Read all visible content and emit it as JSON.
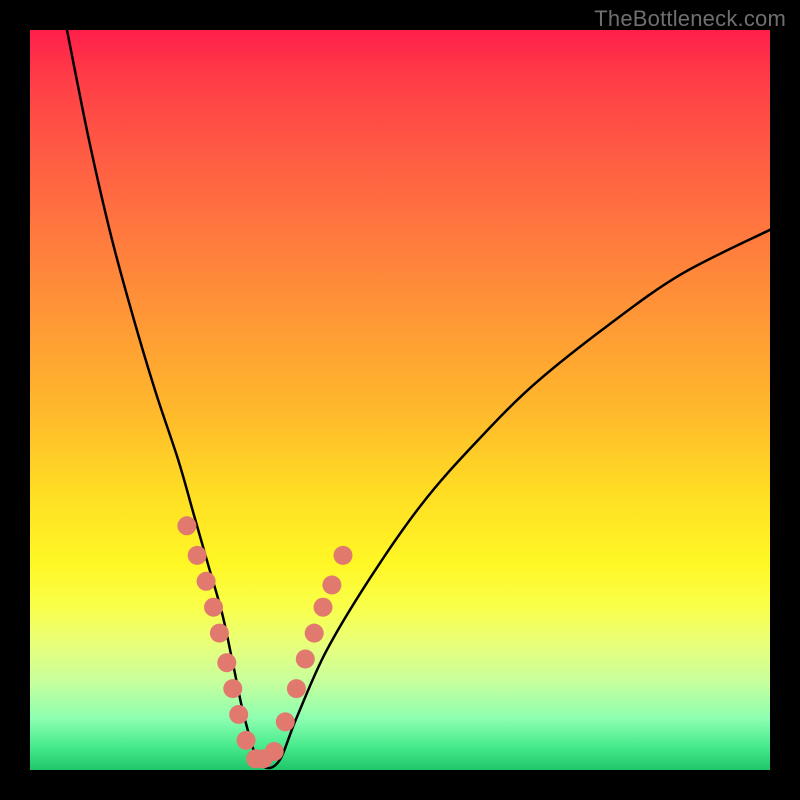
{
  "watermark": "TheBottleneck.com",
  "colors": {
    "frame_bg": "#000000",
    "curve": "#000000",
    "bead_fill": "#e2796f",
    "bead_stroke": "#c9574d",
    "gradient_stops": [
      "#ff1e4a",
      "#ff7a3e",
      "#ffdc24",
      "#f9ff4a",
      "#44e98b",
      "#1fc56a"
    ]
  },
  "chart_data": {
    "type": "line",
    "title": "",
    "xlabel": "",
    "ylabel": "",
    "xlim": [
      0,
      100
    ],
    "ylim": [
      0,
      100
    ],
    "grid": false,
    "legend": false,
    "series": [
      {
        "name": "bottleneck-curve",
        "x": [
          5,
          8,
          11,
          14,
          17,
          20,
          22,
          24,
          26,
          27.5,
          29,
          31,
          33.5,
          36,
          40,
          46,
          53,
          60,
          68,
          78,
          88,
          100
        ],
        "y": [
          100,
          85,
          72,
          61,
          51,
          42,
          35,
          28,
          21,
          14,
          7,
          1,
          1,
          7,
          16,
          26,
          36,
          44,
          52,
          60,
          67,
          73
        ]
      }
    ],
    "beads": {
      "name": "highlight-beads",
      "x": [
        21.2,
        22.6,
        23.8,
        24.8,
        25.6,
        26.6,
        27.4,
        28.2,
        29.2,
        30.5,
        31.5,
        33.0,
        34.5,
        36.0,
        37.2,
        38.4,
        39.6,
        40.8,
        42.3
      ],
      "y": [
        33.0,
        29.0,
        25.5,
        22.0,
        18.5,
        14.5,
        11.0,
        7.5,
        4.0,
        1.5,
        1.5,
        2.5,
        6.5,
        11.0,
        15.0,
        18.5,
        22.0,
        25.0,
        29.0
      ]
    }
  }
}
